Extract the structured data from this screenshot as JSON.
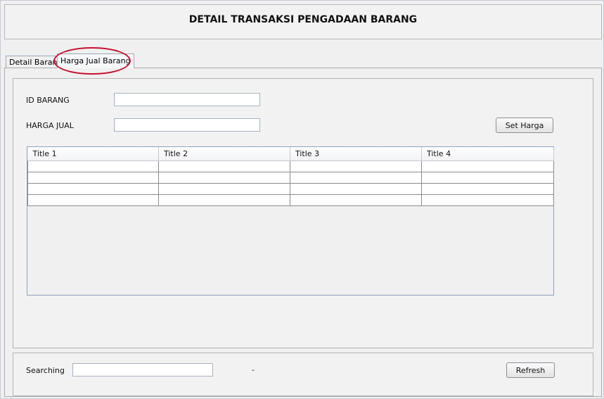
{
  "header": {
    "title": "DETAIL TRANSAKSI PENGADAAN BARANG"
  },
  "tabs": [
    {
      "label": "Detail Barang",
      "selected": false
    },
    {
      "label": "Harga Jual Barang",
      "selected": true
    }
  ],
  "form": {
    "id_barang_label": "ID BARANG",
    "id_barang_value": "",
    "harga_jual_label": "HARGA JUAL",
    "harga_jual_value": "",
    "set_harga_button": "Set Harga"
  },
  "table": {
    "columns": [
      "Title 1",
      "Title 2",
      "Title 3",
      "Title 4"
    ],
    "rows": [
      [
        "",
        "",
        "",
        ""
      ],
      [
        "",
        "",
        "",
        ""
      ],
      [
        "",
        "",
        "",
        ""
      ],
      [
        "",
        "",
        "",
        ""
      ]
    ]
  },
  "search": {
    "label": "Searching",
    "value": "",
    "status": "-",
    "refresh_button": "Refresh"
  },
  "colors": {
    "highlight": "#c8102e",
    "table_border": "#8ea2bf"
  }
}
